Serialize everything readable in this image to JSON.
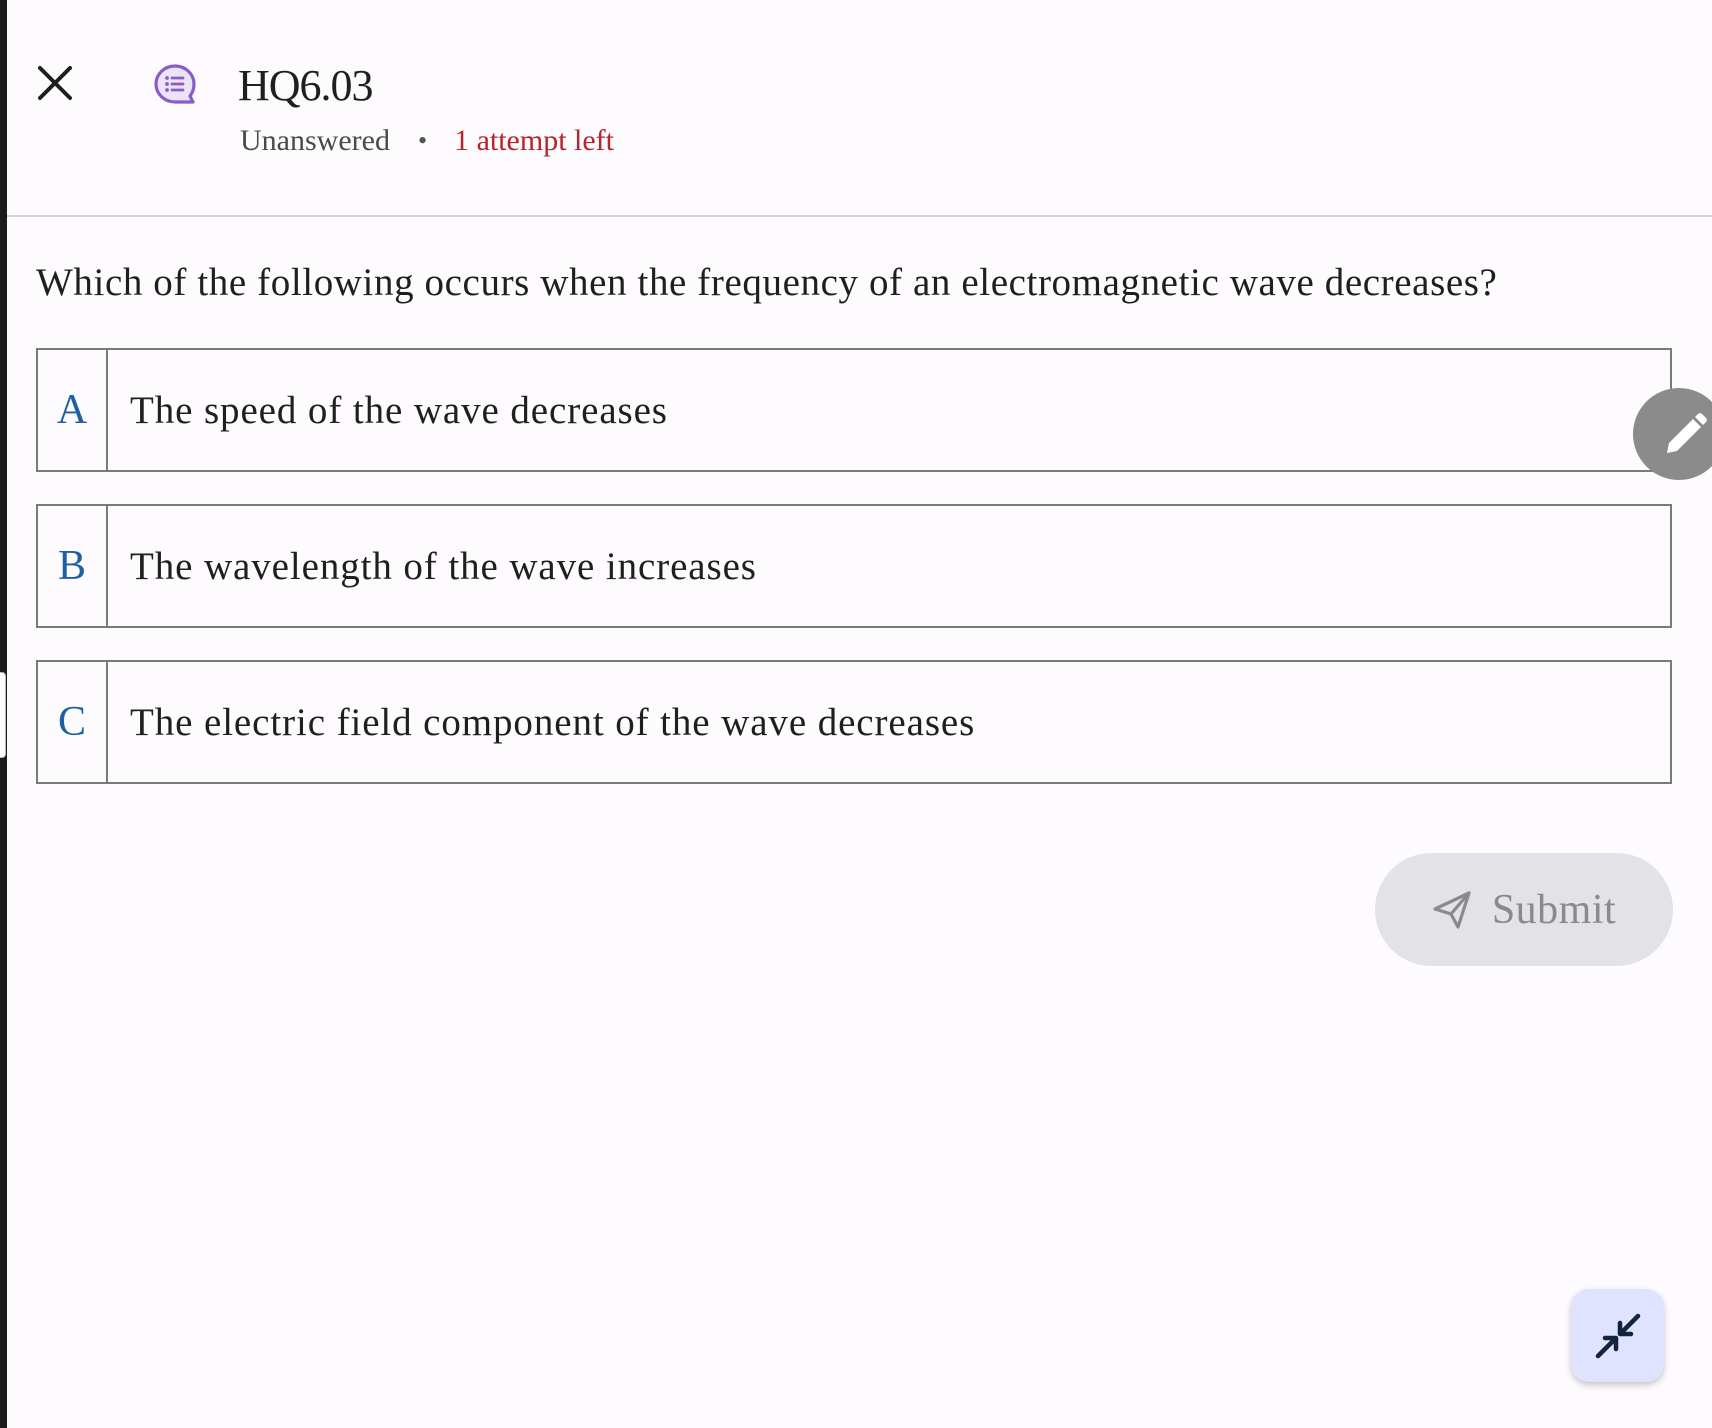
{
  "header": {
    "close_icon": "close-icon",
    "question_type_icon": "chat-list-icon",
    "title": "HQ6.03",
    "status": "Unanswered",
    "separator": "•",
    "attempts": "1 attempt left"
  },
  "question": {
    "text": "Which of the following occurs when the frequency of an electromagnetic wave decreases?"
  },
  "options": [
    {
      "letter": "A",
      "text": "The speed of the wave decreases"
    },
    {
      "letter": "B",
      "text": "The wavelength of the wave increases"
    },
    {
      "letter": "C",
      "text": "The electric field component of the wave decreases"
    }
  ],
  "actions": {
    "submit_label": "Submit",
    "submit_icon": "send-icon",
    "edit_icon": "pencil-icon",
    "collapse_icon": "collapse-icon"
  },
  "colors": {
    "accent_purple": "#8a5cc7",
    "attempts_red": "#b3262d",
    "option_letter_blue": "#1f5fa6",
    "submit_disabled_bg": "#e3e2e5",
    "collapse_fab_bg": "#dfe3ff"
  }
}
